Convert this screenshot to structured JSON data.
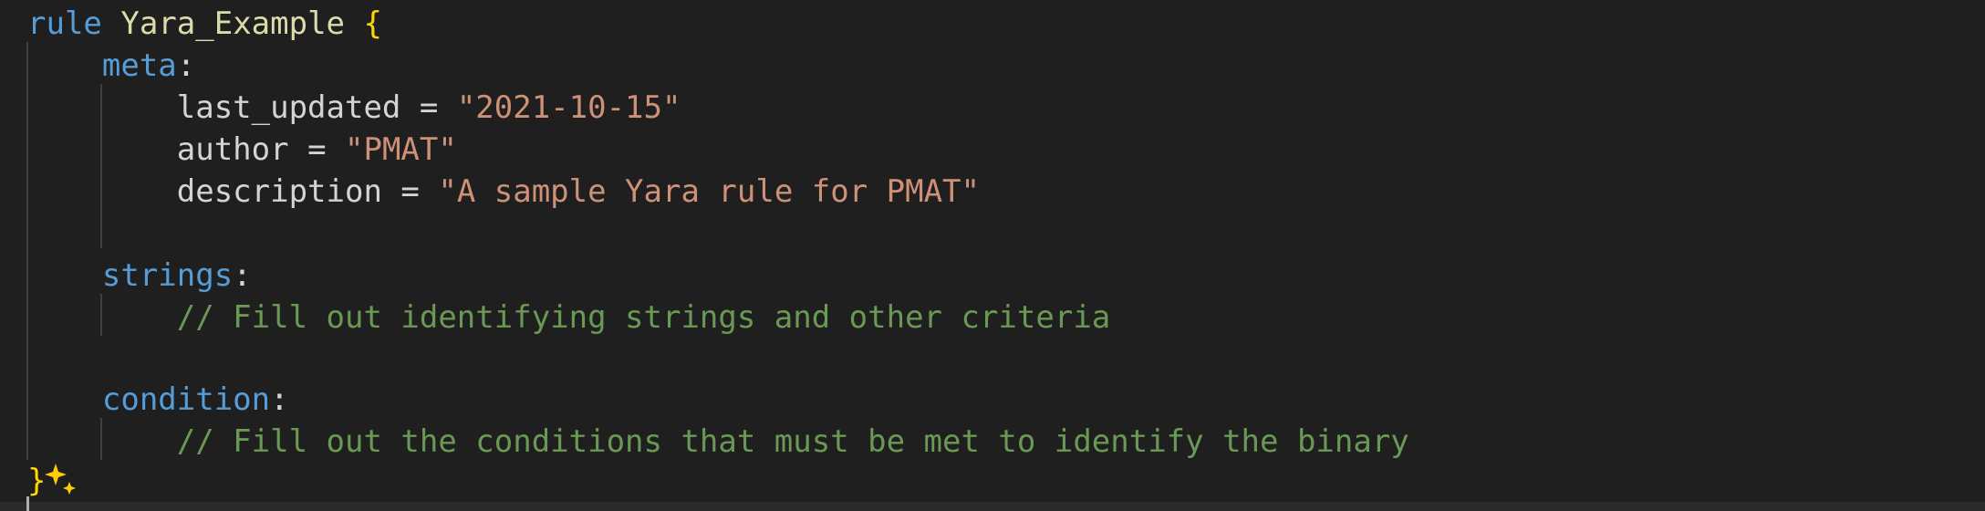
{
  "code": {
    "rule_keyword": "rule",
    "rule_name": "Yara_Example",
    "open_brace": "{",
    "close_brace": "}",
    "meta_keyword": "meta",
    "strings_keyword": "strings",
    "condition_keyword": "condition",
    "colon": ":",
    "equals": " = ",
    "meta_fields": [
      {
        "key": "last_updated",
        "value": "\"2021-10-15\""
      },
      {
        "key": "author",
        "value": "\"PMAT\""
      },
      {
        "key": "description",
        "value": "\"A sample Yara rule for PMAT\""
      }
    ],
    "strings_comment": "// Fill out identifying strings and other criteria",
    "condition_comment": "// Fill out the conditions that must be met to identify the binary"
  },
  "colors": {
    "background": "#1f1f1f",
    "keyword": "#569cd6",
    "identifier": "#dcdcaa",
    "brace": "#ffd700",
    "string": "#ce9178",
    "comment": "#6a9955"
  },
  "icons": {
    "inline_suggestion": "sparkle-icon"
  }
}
